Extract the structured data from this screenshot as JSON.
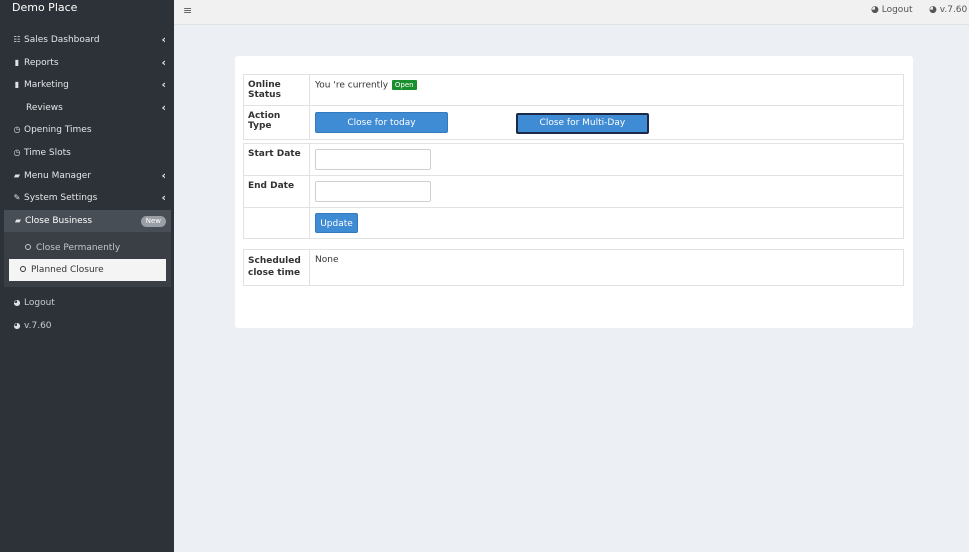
{
  "sidebar": {
    "brand": "Demo Place",
    "menu": [
      {
        "label": "Sales Dashboard",
        "icon": "list-icon",
        "glyph": "☷"
      },
      {
        "label": "Reports",
        "icon": "bar-chart-icon",
        "glyph": "▮"
      },
      {
        "label": "Marketing",
        "icon": "bar-chart-icon",
        "glyph": "▮"
      },
      {
        "label": "Reviews"
      },
      {
        "label": "Opening Times",
        "icon": "clock-icon",
        "glyph": "◷"
      },
      {
        "label": "Time Slots",
        "icon": "clock-icon",
        "glyph": "◷"
      },
      {
        "label": "Menu Manager",
        "icon": "folder-icon",
        "glyph": "▰"
      },
      {
        "label": "System Settings",
        "icon": "wrench-icon",
        "glyph": "✎"
      },
      {
        "label": "Close Business",
        "icon": "folder-open-icon",
        "glyph": "▰",
        "badge": "New"
      }
    ],
    "submenu": [
      {
        "label": "Close Permanently"
      },
      {
        "label": "Planned Closure"
      }
    ],
    "bottom": [
      {
        "label": "Logout",
        "icon": "dashboard-icon",
        "glyph": "◕"
      },
      {
        "label": "v.7.60",
        "icon": "dashboard-icon",
        "glyph": "◕"
      }
    ]
  },
  "topbar": {
    "logout": "Logout",
    "version": "v.7.60"
  },
  "form": {
    "online_status_label": "Online Status",
    "online_status_text": "You 're currently",
    "open_badge": "Open",
    "action_type_label": "Action Type",
    "close_today": "Close for today",
    "close_multi": "Close for Multi-Day",
    "start_date_label": "Start Date",
    "start_date_value": "",
    "end_date_label": "End Date",
    "end_date_value": "",
    "update": "Update",
    "scheduled_label": "Scheduled close time",
    "scheduled_value": "None"
  },
  "colors": {
    "sidebar_bg": "#2d3238",
    "accent_blue": "#3f8bd4",
    "open_green": "#1a8f2e"
  }
}
